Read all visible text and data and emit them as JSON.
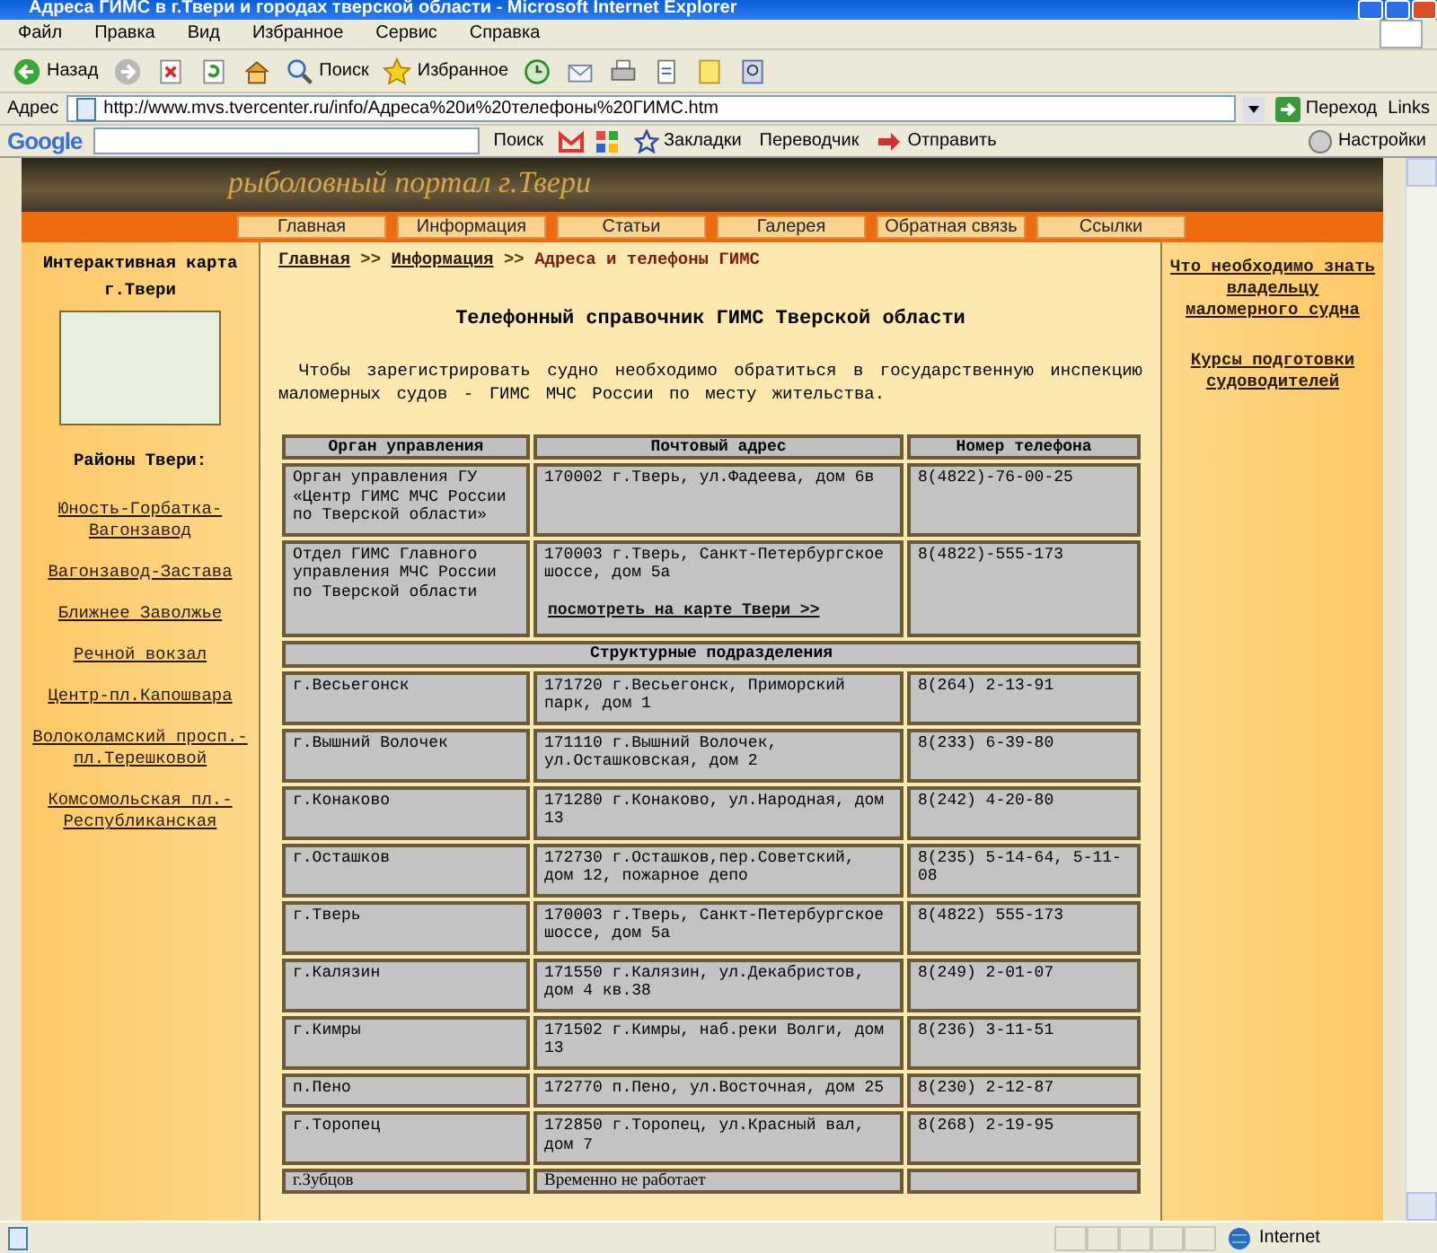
{
  "window": {
    "title": "Адреса ГИМС в г.Твери и городах тверской области - Microsoft Internet Explorer"
  },
  "menu": [
    "Файл",
    "Правка",
    "Вид",
    "Избранное",
    "Сервис",
    "Справка"
  ],
  "toolbar": [
    {
      "kind": "back",
      "label": "Назад"
    },
    {
      "kind": "forward"
    },
    {
      "kind": "stop"
    },
    {
      "kind": "refresh"
    },
    {
      "kind": "home"
    },
    {
      "kind": "search",
      "label": "Поиск"
    },
    {
      "kind": "favorites",
      "label": "Избранное"
    },
    {
      "kind": "history"
    },
    {
      "kind": "mail"
    },
    {
      "kind": "print"
    },
    {
      "kind": "edit"
    },
    {
      "kind": "folder"
    },
    {
      "kind": "research"
    }
  ],
  "address_bar": {
    "label": "Адрес",
    "url": "http://www.mvs.tvercenter.ru/info/Адреса%20и%20телефоны%20ГИМС.htm",
    "go": "Переход",
    "links": "Links"
  },
  "google_bar": {
    "logo": "Google",
    "search": "Поиск",
    "bookmarks": "Закладки",
    "translator": "Переводчик",
    "send": "Отправить",
    "settings": "Настройки"
  },
  "banner": {
    "caption": "рыболовный портал г.Твери"
  },
  "nav": [
    "Главная",
    "Информация",
    "Статьи",
    "Галерея",
    "Обратная связь",
    "Ссылки"
  ],
  "left_sidebar": {
    "map_title": "Интерактивная карта г.Твери",
    "districts_title": "Районы Твери:",
    "districts": [
      "Юность-Горбатка-Вагонзавод",
      "Вагонзавод-Застава",
      "Ближнее Заволжье",
      "Речной вокзал",
      "Центр-пл.Капошвара",
      "Волоколамский просп.-пл.Терешковой",
      "Комсомольская пл.-Республиканская"
    ]
  },
  "breadcrumb": {
    "separator": ">>",
    "items": [
      {
        "label": "Главная",
        "link": true
      },
      {
        "label": "Информация",
        "link": true
      },
      {
        "label": "Адреса и телефоны ГИМС",
        "link": false
      }
    ]
  },
  "heading": "Телефонный справочник ГИМС Тверской области",
  "intro": "Чтобы зарегистрировать судно необходимо обратиться в государственную инспекцию маломерных судов  - ГИМС МЧС России по месту жительства.",
  "table": {
    "columns": [
      "Орган управления",
      "Почтовый адрес",
      "Номер телефона"
    ],
    "rows": [
      {
        "kind": "main",
        "cells": [
          "Орган управления ГУ «Центр ГИМС МЧС России по Тверской области»",
          "170002 г.Тверь, ул.Фадеева, дом 6в",
          "8(4822)-76-00-25"
        ]
      },
      {
        "kind": "main",
        "cells": [
          "Отдел ГИМС Главного управления МЧС России по Тверской области",
          "170003 г.Тверь, Санкт-Петербургское шоссе, дом 5а",
          "8(4822)-555-173"
        ],
        "link": "посмотреть на карте Твери >>"
      },
      {
        "kind": "section",
        "cells": [
          {
            "text": "Структурные подразделения",
            "colspan": 3
          }
        ]
      },
      {
        "kind": "main",
        "cells": [
          "г.Весьегонск",
          "171720 г.Весьегонск, Приморский парк, дом 1",
          "8(264) 2-13-91"
        ]
      },
      {
        "kind": "main",
        "cells": [
          "г.Вышний Волочек",
          "171110 г.Вышний Волочек, ул.Осташковская, дом 2",
          "8(233) 6-39-80"
        ]
      },
      {
        "kind": "main",
        "cells": [
          "г.Конаково",
          "171280 г.Конаково, ул.Народная, дом 13",
          "8(242) 4-20-80"
        ]
      },
      {
        "kind": "main",
        "cells": [
          "г.Осташков",
          "172730 г.Осташков,пер.Советский, дом 12, пожарное депо",
          "8(235) 5-14-64, 5-11-08"
        ]
      },
      {
        "kind": "main",
        "cells": [
          "г.Тверь",
          "170003 г.Тверь, Санкт-Петербургское шоссе, дом 5а",
          "8(4822) 555-173"
        ]
      },
      {
        "kind": "main",
        "cells": [
          "г.Калязин",
          "171550 г.Калязин, ул.Декабристов, дом 4 кв.38",
          "8(249) 2-01-07"
        ]
      },
      {
        "kind": "main",
        "cells": [
          "г.Кимры",
          "171502 г.Кимры, наб.реки Волги, дом 13",
          "8(236) 3-11-51"
        ]
      },
      {
        "kind": "main",
        "cells": [
          "п.Пено",
          "172770 п.Пено, ул.Восточная, дом 25",
          "8(230) 2-12-87"
        ]
      },
      {
        "kind": "main",
        "cells": [
          "г.Торопец",
          "172850 г.Торопец, ул.Красный вал, дом 7",
          "8(268) 2-19-95"
        ]
      },
      {
        "kind": "plain",
        "cells": [
          "г.Зубцов",
          "Временно не работает"
        ]
      }
    ]
  },
  "right_sidebar": [
    "Что необходимо знать владельцу маломерного судна",
    "Курсы подготовки судоводителей"
  ],
  "status_bar": {
    "zone": "Internet"
  }
}
